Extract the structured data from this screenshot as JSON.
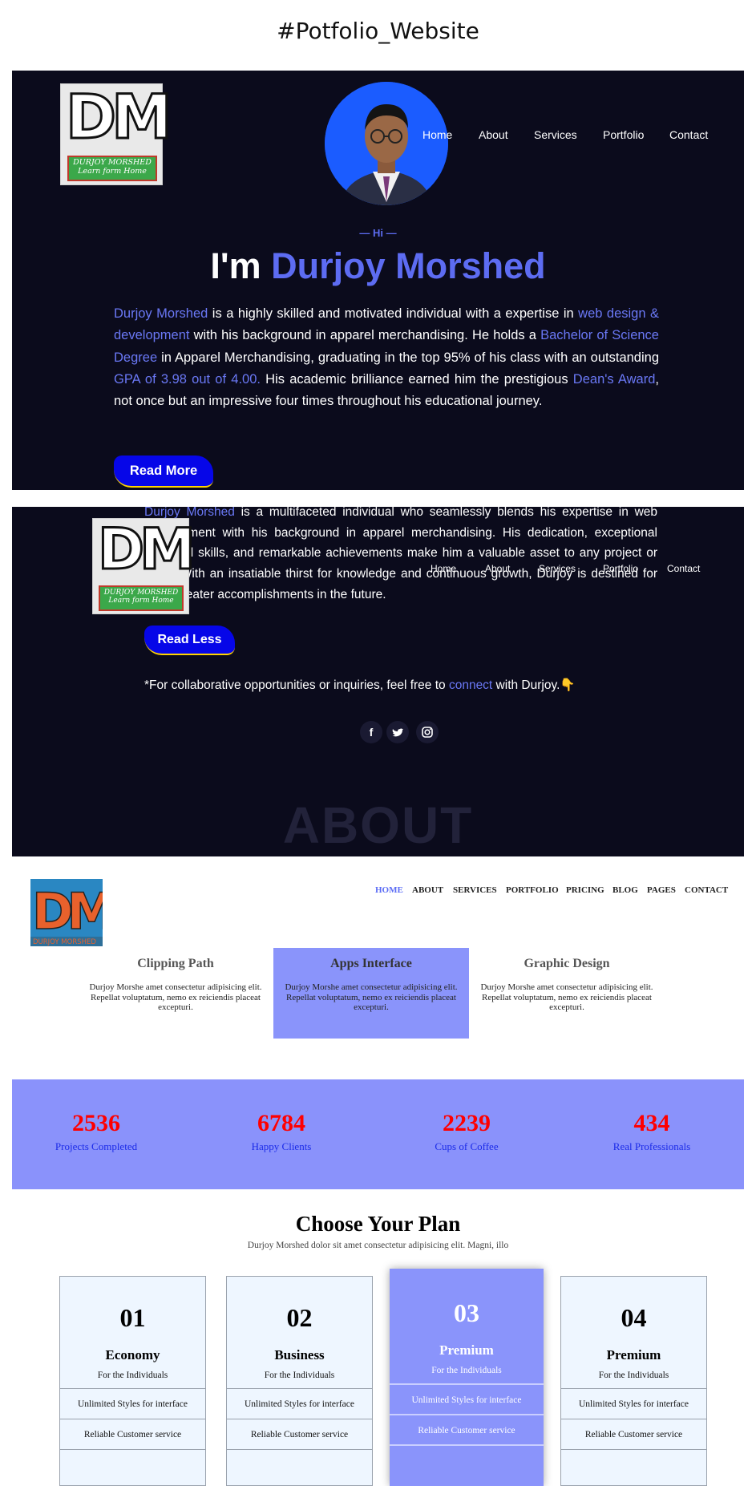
{
  "page_heading": "#Potfolio_Website",
  "hero": {
    "logo": {
      "letters": "DM",
      "line1": "DURJOY MORSHED",
      "line2": "Learn form Home"
    },
    "nav": [
      "Home",
      "About",
      "Services",
      "Portfolio",
      "Contact"
    ],
    "greeting": "— Hi —",
    "title_prefix": "I'm ",
    "title_name": "Durjoy Morshed",
    "bio": [
      {
        "t": "Durjoy Morshed",
        "h": true
      },
      {
        "t": " is a highly skilled and motivated individual with a expertise in ",
        "h": false
      },
      {
        "t": "web design & development",
        "h": true
      },
      {
        "t": " with his background in apparel merchandising. He holds a ",
        "h": false
      },
      {
        "t": "Bachelor of Science Degree",
        "h": true
      },
      {
        "t": " in Apparel Merchandising, graduating in the top 95% of his class with an outstanding ",
        "h": false
      },
      {
        "t": "GPA of 3.98 out of 4.00.",
        "h": true
      },
      {
        "t": " His academic brilliance earned him the prestigious ",
        "h": false
      },
      {
        "t": "Dean's Award",
        "h": true
      },
      {
        "t": ", not once but an impressive four times throughout his educational journey.",
        "h": false
      }
    ],
    "read_more": "Read More"
  },
  "section2": {
    "logo": {
      "letters": "DM",
      "line1": "DURJOY MORSHED",
      "line2": "Learn form Home"
    },
    "nav": [
      "Home",
      "About",
      "Services",
      "Portfolio",
      "Contact"
    ],
    "bio": [
      {
        "t": "Durjoy Morshed",
        "h": true
      },
      {
        "t": " is a multifaceted individual who seamlessly blends his expertise in web development with his background in apparel merchandising. His dedication, exceptional technical skills, and remarkable achievements make him a valuable asset to any project or team. With an insatiable thirst for knowledge and continuous growth, Durjoy is destined for even greater accomplishments in the future.",
        "h": false
      }
    ],
    "read_less": "Read Less",
    "connect_prefix": "*For collaborative opportunities or inquiries, feel free to ",
    "connect_link": "connect",
    "connect_suffix": " with Durjoy.",
    "connect_emoji": "👇",
    "social": [
      {
        "icon": "facebook-icon",
        "glyph": "f"
      },
      {
        "icon": "twitter-icon",
        "glyph": "t"
      },
      {
        "icon": "instagram-icon",
        "glyph": "◎"
      }
    ],
    "watermark": "ABOUT"
  },
  "site3": {
    "logo_letters": "DM",
    "logo_text": "DURJOY MORSHED",
    "nav": [
      "HOME",
      "ABOUT",
      "SERVICES",
      "PORTFOLIO",
      "PRICING",
      "BLOG",
      "PAGES",
      "CONTACT"
    ],
    "nav_active_color": "#5b6cf5",
    "services": [
      {
        "title": "Clipping Path",
        "text": "Durjoy Morshe amet consectetur adipisicing elit. Repellat voluptatum, nemo ex reiciendis placeat excepturi."
      },
      {
        "title": "Apps Interface",
        "text": "Durjoy Morshe amet consectetur adipisicing elit. Repellat voluptatum, nemo ex reiciendis placeat excepturi."
      },
      {
        "title": "Graphic Design",
        "text": "Durjoy Morshe amet consectetur adipisicing elit. Repellat voluptatum, nemo ex reiciendis placeat excepturi."
      }
    ]
  },
  "stats": [
    {
      "num": "2536",
      "label": "Projects Completed"
    },
    {
      "num": "6784",
      "label": "Happy Clients"
    },
    {
      "num": "2239",
      "label": "Cups of Coffee"
    },
    {
      "num": "434",
      "label": "Real Professionals"
    }
  ],
  "pricing": {
    "title": "Choose Your Plan",
    "subtitle": "Durjoy Morshed dolor sit amet consectetur adipisicing elit. Magni, illo",
    "plans": [
      {
        "num": "01",
        "name": "Economy",
        "for": "For the Individuals",
        "features": [
          "Unlimited Styles for interface",
          "Reliable Customer service"
        ]
      },
      {
        "num": "02",
        "name": "Business",
        "for": "For the Individuals",
        "features": [
          "Unlimited Styles for interface",
          "Reliable Customer service"
        ]
      },
      {
        "num": "03",
        "name": "Premium",
        "for": "For the Individuals",
        "features": [
          "Unlimited Styles for interface",
          "Reliable Customer service"
        ]
      },
      {
        "num": "04",
        "name": "Premium",
        "for": "For the Individuals",
        "features": [
          "Unlimited Styles for interface",
          "Reliable Customer service"
        ]
      }
    ]
  },
  "colors": {
    "dark_bg": "#0b0b1c",
    "accent": "#5d6cf2",
    "button_blue": "#0606e8",
    "stats_bg": "#8a92fb",
    "stat_number": "#ff0000"
  }
}
